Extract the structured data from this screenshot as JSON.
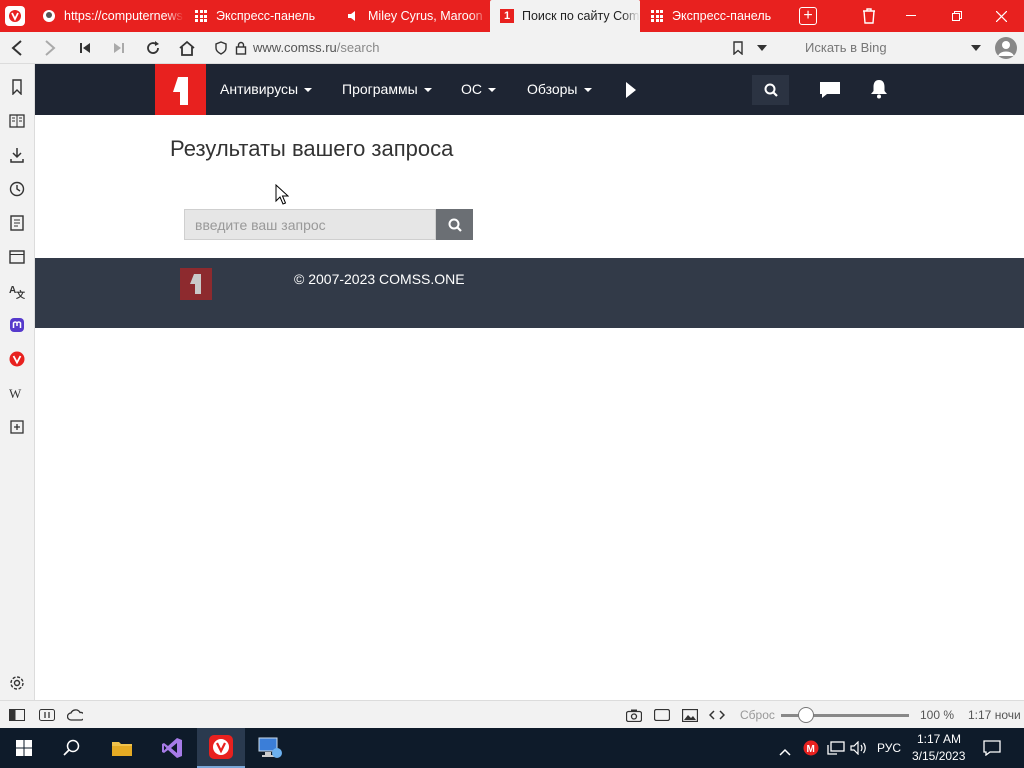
{
  "browser": {
    "tabs": [
      {
        "title": "https://computernews",
        "icon": "site-icon",
        "active": false
      },
      {
        "title": "Экспресс-панель",
        "icon": "speed-dial-icon",
        "active": false
      },
      {
        "title": "Miley Cyrus, Maroon",
        "icon": "audio-icon",
        "active": false
      },
      {
        "title": "Поиск по сайту Coms",
        "icon": "comss-logo-icon",
        "active": true
      },
      {
        "title": "Экспресс-панель",
        "icon": "speed-dial-icon",
        "active": false
      }
    ],
    "address": {
      "url_domain": "www.comss.ru",
      "url_path": "/search",
      "search_placeholder": "Искать в Bing"
    },
    "status": {
      "reset_label": "Сброс",
      "zoom": "100 %",
      "zoom_fraction": 0.2,
      "clock": "1:17 ночи"
    }
  },
  "site": {
    "nav": [
      "Антивирусы",
      "Программы",
      "ОС",
      "Обзоры"
    ],
    "page_title": "Результаты вашего запроса",
    "search_placeholder": "введите ваш запрос",
    "footer_copyright": "© 2007-2023 COMSS.ONE"
  },
  "taskbar": {
    "time": "1:17 AM",
    "date": "3/15/2023",
    "language": "РУС"
  },
  "colors": {
    "brand_red": "#e8211f",
    "nav_dark": "#1e2533",
    "footer_dark": "#323a48",
    "taskbar": "#0e1b2a"
  }
}
